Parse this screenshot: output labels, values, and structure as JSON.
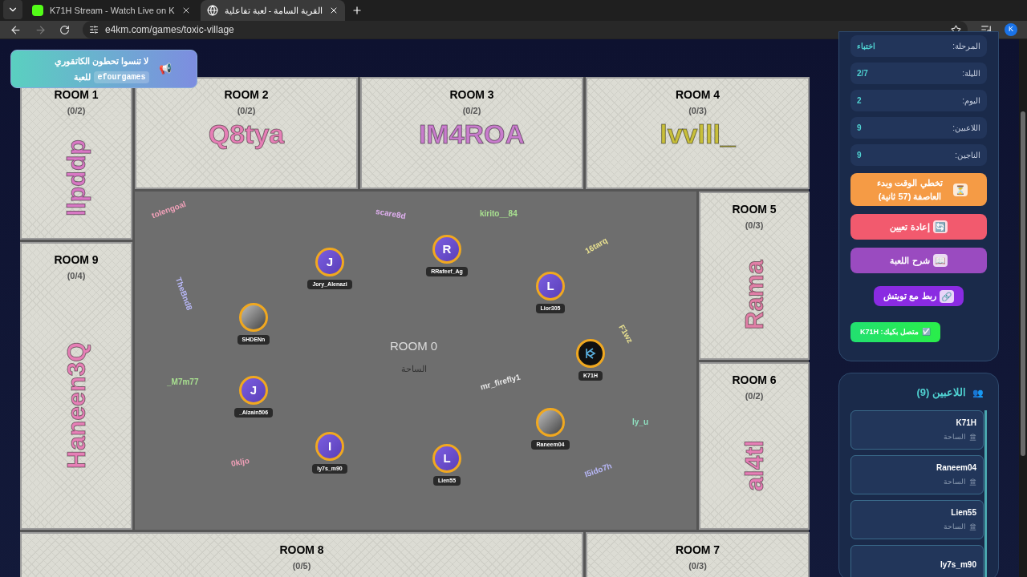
{
  "browser": {
    "tabs": [
      {
        "title": "K71H Stream - Watch Live on K",
        "selected": false
      },
      {
        "title": "القرية السامة - لعبة تفاعلية",
        "selected": true
      }
    ],
    "url": "e4km.com/games/toxic-village",
    "profile": "K"
  },
  "toast": {
    "icon": "📢",
    "before": "لا تنسوا تحطون الكاتقوري",
    "code": "efourgames",
    "after": "للعبة"
  },
  "map": {
    "rooms": [
      {
        "label": "ROOM 1",
        "count": "(0/2)",
        "owner": "llpddp",
        "color": "#d878c4",
        "vertical": true
      },
      {
        "label": "ROOM 2",
        "count": "(0/2)",
        "owner": "Q8tya",
        "color": "#e67fb6",
        "vertical": false
      },
      {
        "label": "ROOM 3",
        "count": "(0/2)",
        "owner": "IM4ROA",
        "color": "#c87ccc",
        "vertical": false
      },
      {
        "label": "ROOM 4",
        "count": "(0/3)",
        "owner": "lvvlll_",
        "color": "#c8bf3a",
        "vertical": false
      },
      {
        "label": "ROOM 5",
        "count": "(0/3)",
        "owner": "Rama",
        "color": "#e07fa6",
        "vertical": true
      },
      {
        "label": "ROOM 9",
        "count": "(0/4)",
        "owner": "Haneen3Q",
        "color": "#e67fb6",
        "vertical": true
      },
      {
        "label": "ROOM 6",
        "count": "(0/2)",
        "owner": "al4tl",
        "color": "#e67fb6",
        "vertical": true
      },
      {
        "label": "ROOM 8",
        "count": "(0/5)"
      },
      {
        "label": "ROOM 7",
        "count": "(0/3)"
      }
    ],
    "center": {
      "label": "ROOM 0",
      "sublabel": "الساحة"
    },
    "scribbles": [
      "tolengoal",
      "kirito__84",
      "16tarq",
      "TheBnd8",
      "scare8d",
      "mr_firefly1",
      "ly_u",
      "0kljo",
      "_M7m77",
      "F1wz",
      "I5ido7h"
    ],
    "players": [
      {
        "name": "Jory_Alenazi",
        "initial": "J",
        "kind": "letter"
      },
      {
        "name": "RRafeef_Ag",
        "initial": "R",
        "kind": "letter"
      },
      {
        "name": "Lior305",
        "initial": "L",
        "kind": "letter"
      },
      {
        "name": "SHDENn",
        "kind": "photo"
      },
      {
        "name": "K71H",
        "kind": "logo"
      },
      {
        "name": "_Alzain506",
        "initial": "J",
        "kind": "letter"
      },
      {
        "name": "Raneem04",
        "kind": "photo"
      },
      {
        "name": "ly7s_m90",
        "initial": "I",
        "kind": "letter"
      },
      {
        "name": "Lien55",
        "initial": "L",
        "kind": "letter"
      }
    ]
  },
  "stats": [
    {
      "label": "المرحلة:",
      "value": "اختباء"
    },
    {
      "label": "الليلة:",
      "value": "2/7"
    },
    {
      "label": "اليوم:",
      "value": "2"
    },
    {
      "label": "اللاعبين:",
      "value": "9"
    },
    {
      "label": "الناجين:",
      "value": "9"
    }
  ],
  "actions": [
    {
      "icon": "⏳",
      "label": "تخطي الوقت وبدء العاصفة (57 ثانية)",
      "kind": "orange"
    },
    {
      "icon": "🔄",
      "label": "إعادة تعيين",
      "kind": "red"
    },
    {
      "icon": "📖",
      "label": "شرح اللعبة",
      "kind": "purple"
    },
    {
      "icon": "🔗",
      "label": "ربط مع تويتش",
      "kind": "violet"
    }
  ],
  "connected": {
    "icon": "☑️",
    "label": "متصل بكيك: K71H"
  },
  "players_panel": {
    "icon": "👥",
    "title": "اللاعبين (9)",
    "items": [
      {
        "name": "K71H",
        "location": "الساحة"
      },
      {
        "name": "Raneem04",
        "location": "الساحة"
      },
      {
        "name": "Lien55",
        "location": "الساحة"
      },
      {
        "name": "ly7s_m90"
      }
    ]
  }
}
